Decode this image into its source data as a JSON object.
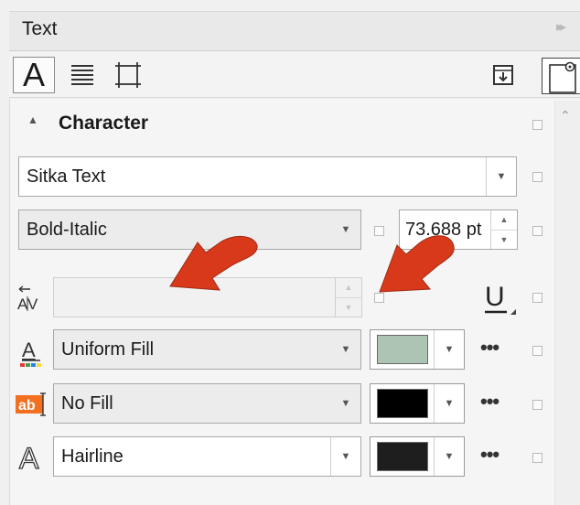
{
  "panel": {
    "title": "Text",
    "collapse_glyph": "▸▸"
  },
  "toolbar": {
    "character_tool_glyph": "A",
    "paragraph_icon": "paragraph-lines-icon",
    "frame_icon": "text-frame-icon",
    "import_icon": "import-text-icon",
    "card_icon": "frame-properties-icon"
  },
  "section": {
    "label": "Character",
    "toggle_glyph": "▲",
    "scroll_up_glyph": "⌃"
  },
  "font": {
    "family": "Sitka Text",
    "style": "Bold-Italic",
    "size": "73.688 pt"
  },
  "kerning": {
    "value": "",
    "icon": "kerning-icon"
  },
  "underline": {
    "glyph": "U",
    "icon": "underline-icon"
  },
  "text_fill": {
    "type": "Uniform Fill",
    "color": "#adc3b3",
    "icon": "text-fill-icon"
  },
  "background_fill": {
    "type": "No Fill",
    "color": "#000000",
    "icon": "background-fill-icon",
    "icon_text": "ab"
  },
  "outline": {
    "type": "Hairline",
    "color": "#1e1e1e",
    "icon": "outline-icon",
    "icon_glyph": "A"
  },
  "more_glyph": "•••",
  "dropdown_glyph": "▼",
  "spin_up_glyph": "▲",
  "spin_down_glyph": "▼",
  "annotation_color": "#d9391b"
}
